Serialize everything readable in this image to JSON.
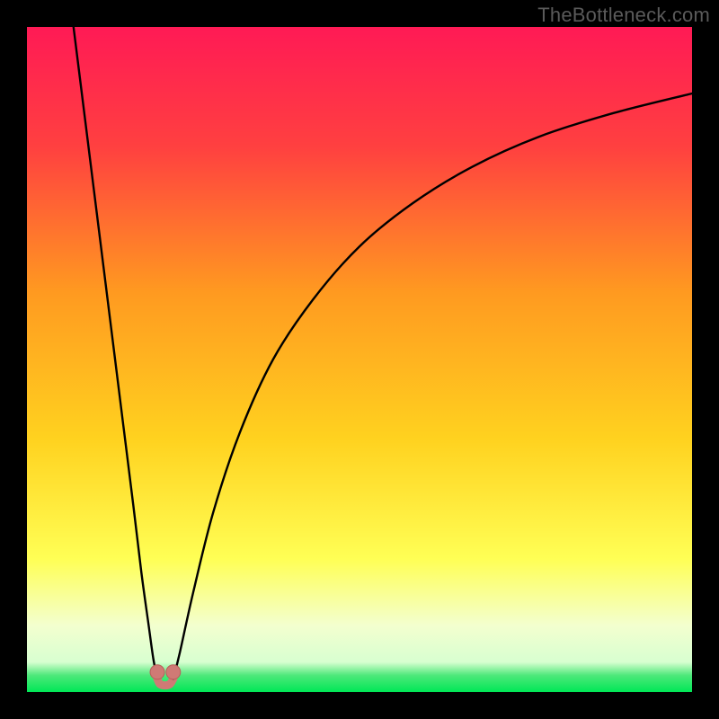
{
  "watermark": "TheBottleneck.com",
  "colors": {
    "page_bg": "#000000",
    "curve": "#000000",
    "marker_fill": "#cf7a75",
    "marker_stroke": "#b85f5a",
    "gradient_top": "#ff1a55",
    "gradient_mid_upper": "#ff7a2a",
    "gradient_mid": "#ffd21f",
    "gradient_mid_lower": "#ffff66",
    "gradient_pale": "#f6ffd6",
    "gradient_bottom": "#00e756"
  },
  "chart_data": {
    "type": "line",
    "title": "",
    "xlabel": "",
    "ylabel": "",
    "xlim": [
      0,
      100
    ],
    "ylim": [
      0,
      100
    ],
    "grid": false,
    "legend": false,
    "series": [
      {
        "name": "left-branch",
        "x": [
          7.0,
          8.5,
          10.0,
          11.5,
          13.0,
          14.5,
          16.0,
          17.2,
          18.3,
          19.0,
          19.6
        ],
        "y": [
          100.0,
          88.0,
          76.0,
          64.0,
          52.0,
          40.0,
          28.0,
          18.0,
          10.0,
          5.0,
          2.0
        ]
      },
      {
        "name": "right-branch",
        "x": [
          22.0,
          23.0,
          25.0,
          28.0,
          32.0,
          37.0,
          43.0,
          50.0,
          58.0,
          67.0,
          77.0,
          88.0,
          100.0
        ],
        "y": [
          2.0,
          6.0,
          15.0,
          27.0,
          39.0,
          50.0,
          59.0,
          67.0,
          73.5,
          79.0,
          83.5,
          87.0,
          90.0
        ]
      },
      {
        "name": "trough",
        "x": [
          19.6,
          20.0,
          20.8,
          21.5,
          22.0
        ],
        "y": [
          2.0,
          1.2,
          1.0,
          1.2,
          2.0
        ]
      }
    ],
    "markers": [
      {
        "name": "trough-left",
        "x": 19.6,
        "y": 3.0
      },
      {
        "name": "trough-right",
        "x": 22.0,
        "y": 3.0
      }
    ],
    "gradient_stops": [
      {
        "offset": 0.0,
        "color": "#ff1a55"
      },
      {
        "offset": 0.18,
        "color": "#ff4040"
      },
      {
        "offset": 0.4,
        "color": "#ff9a20"
      },
      {
        "offset": 0.62,
        "color": "#ffd21f"
      },
      {
        "offset": 0.8,
        "color": "#ffff55"
      },
      {
        "offset": 0.9,
        "color": "#f3ffcf"
      },
      {
        "offset": 0.955,
        "color": "#d8ffd0"
      },
      {
        "offset": 0.975,
        "color": "#4de87a"
      },
      {
        "offset": 1.0,
        "color": "#00e756"
      }
    ]
  }
}
